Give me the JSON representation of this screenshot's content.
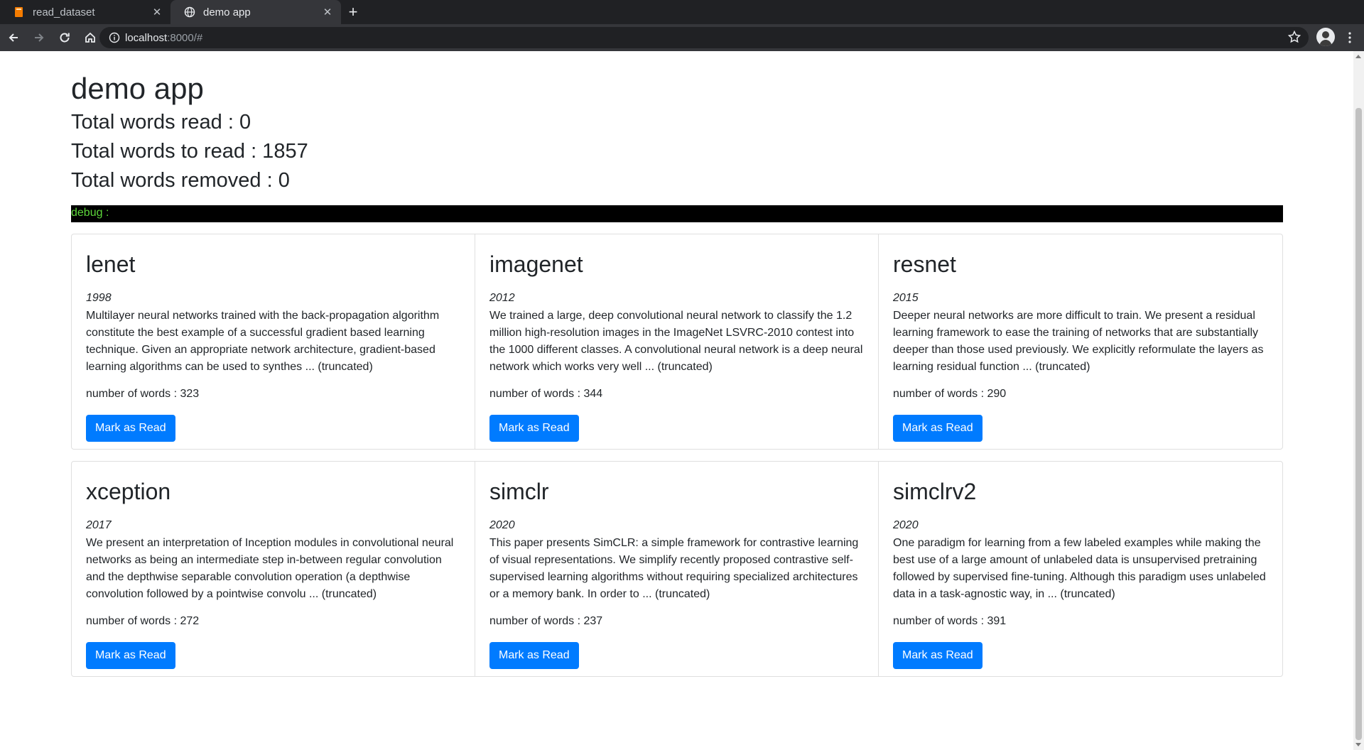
{
  "browser": {
    "tabs": [
      {
        "title": "read_dataset",
        "icon": "book-icon",
        "active": false
      },
      {
        "title": "demo app",
        "icon": "globe-icon",
        "active": true
      }
    ],
    "url_host": "localhost",
    "url_rest": ":8000/#"
  },
  "app": {
    "title": "demo app",
    "stats": {
      "read": "Total words read : 0",
      "to_read": "Total words to read : 1857",
      "removed": "Total words removed : 0"
    },
    "debug": "debug :",
    "button_label": "Mark as Read",
    "papers": [
      {
        "name": "lenet",
        "year": "1998",
        "abstract": "Multilayer neural networks trained with the back-propagation algorithm constitute the best example of a successful gradient based learning technique. Given an appropriate network architecture, gradient-based learning algorithms can be used to synthes ... (truncated)",
        "words": "number of words : 323"
      },
      {
        "name": "imagenet",
        "year": "2012",
        "abstract": "We trained a large, deep convolutional neural network to classify the 1.2 million high-resolution images in the ImageNet LSVRC-2010 contest into the 1000 different classes. A convolutional neural network is a deep neural network which works very well ... (truncated)",
        "words": "number of words : 344"
      },
      {
        "name": "resnet",
        "year": "2015",
        "abstract": "Deeper neural networks are more difficult to train. We present a residual learning framework to ease the training of networks that are substantially deeper than those used previously. We explicitly reformulate the layers as learning residual function ... (truncated)",
        "words": "number of words : 290"
      },
      {
        "name": "xception",
        "year": "2017",
        "abstract": "We present an interpretation of Inception modules in convolutional neural networks as being an intermediate step in-between regular convolution and the depthwise separable convolution operation (a depthwise convolution followed by a pointwise convolu ... (truncated)",
        "words": "number of words : 272"
      },
      {
        "name": "simclr",
        "year": "2020",
        "abstract": "This paper presents SimCLR: a simple framework for contrastive learning of visual representations. We simplify recently proposed contrastive self-supervised learning algorithms without requiring specialized architectures or a memory bank. In order to ... (truncated)",
        "words": "number of words : 237"
      },
      {
        "name": "simclrv2",
        "year": "2020",
        "abstract": "One paradigm for learning from a few labeled examples while making the best use of a large amount of unlabeled data is unsupervised pretraining followed by supervised fine-tuning. Although this paradigm uses unlabeled data in a task-agnostic way, in ... (truncated)",
        "words": "number of words : 391"
      }
    ]
  },
  "colors": {
    "primary_button": "#007bff",
    "debug_text": "#5cd63a",
    "debug_bg": "#000000"
  }
}
